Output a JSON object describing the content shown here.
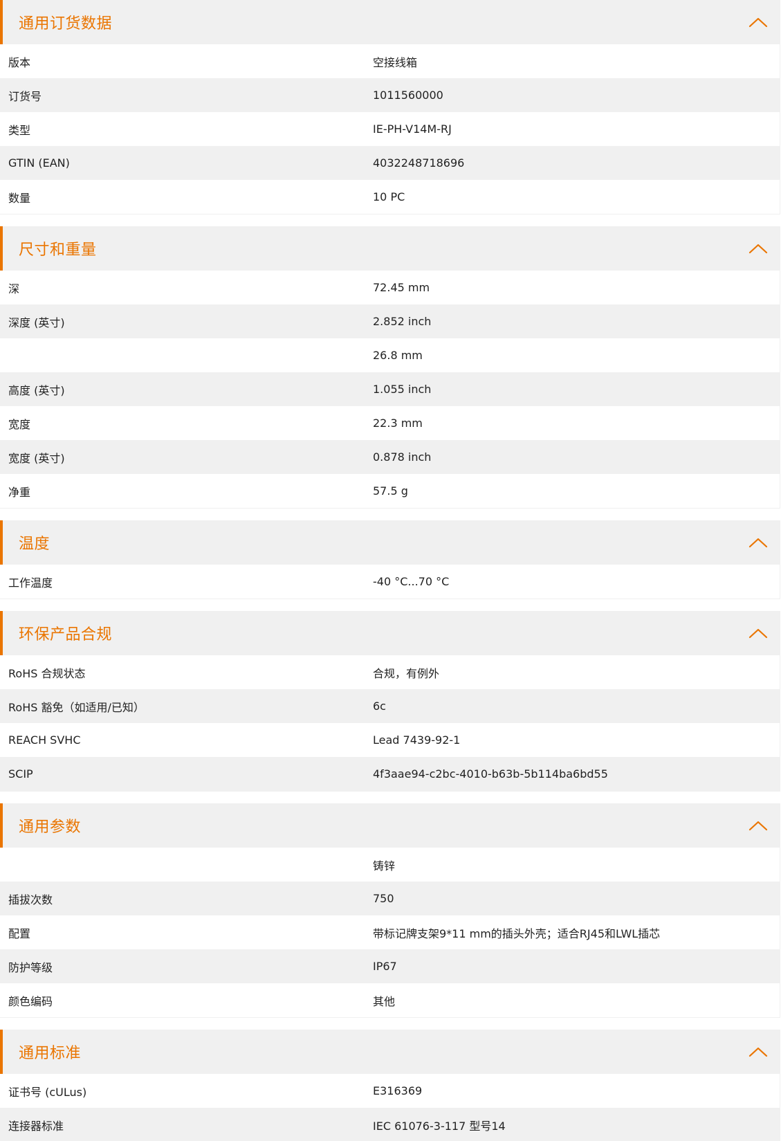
{
  "sections": [
    {
      "title": "通用订货数据",
      "rows": [
        {
          "label": "版本",
          "value": "空接线箱"
        },
        {
          "label": "订货号",
          "value": "1011560000"
        },
        {
          "label": "类型",
          "value": "IE-PH-V14M-RJ"
        },
        {
          "label": "GTIN (EAN)",
          "value": "4032248718696"
        },
        {
          "label": "数量",
          "value": "10  PC"
        }
      ]
    },
    {
      "title": "尺寸和重量",
      "rows": [
        {
          "label": "深",
          "value": "72.45  mm"
        },
        {
          "label": "深度 (英寸)",
          "value": "2.852  inch"
        },
        {
          "label": "",
          "value": "26.8  mm"
        },
        {
          "label": "高度 (英寸)",
          "value": "1.055  inch"
        },
        {
          "label": "宽度",
          "value": "22.3  mm"
        },
        {
          "label": "宽度 (英寸)",
          "value": "0.878  inch"
        },
        {
          "label": "净重",
          "value": "57.5  g"
        }
      ]
    },
    {
      "title": "温度",
      "rows": [
        {
          "label": "工作温度",
          "value": "-40 °C...70 °C"
        }
      ]
    },
    {
      "title": "环保产品合规",
      "rows": [
        {
          "label": "RoHS 合规状态",
          "value": "合规，有例外"
        },
        {
          "label": "RoHS 豁免（如适用/已知）",
          "value": "6c"
        },
        {
          "label": "REACH SVHC",
          "value": "Lead 7439-92-1"
        },
        {
          "label": "SCIP",
          "value": "4f3aae94-c2bc-4010-b63b-5b114ba6bd55"
        }
      ]
    },
    {
      "title": "通用参数",
      "rows": [
        {
          "label": "",
          "value": "铸锌"
        },
        {
          "label": "插拔次数",
          "value": "750"
        },
        {
          "label": "配置",
          "value": "带标记牌支架9*11 mm的插头外壳；适合RJ45和LWL插芯"
        },
        {
          "label": "防护等级",
          "value": "IP67"
        },
        {
          "label": "颜色编码",
          "value": "其他"
        }
      ]
    },
    {
      "title": "通用标准",
      "rows": [
        {
          "label": "证书号 (cULus)",
          "value": "E316369"
        },
        {
          "label": "连接器标准",
          "value": "IEC 61076-3-117 型号14"
        }
      ]
    }
  ],
  "icons": {
    "toggle": "chevron-up-icon"
  },
  "colors": {
    "accent": "#ea7500",
    "header_bg": "#f0f0f0",
    "alt_row_bg": "#f0f0f0",
    "text": "#222222"
  }
}
